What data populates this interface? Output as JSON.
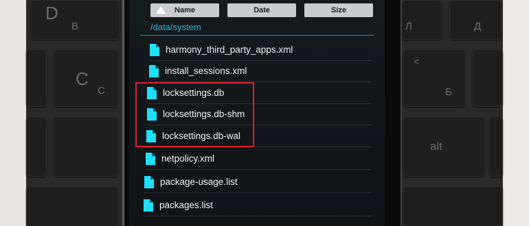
{
  "header": {
    "sort_name": "Name",
    "sort_date": "Date",
    "sort_size": "Size"
  },
  "path": "/data/system",
  "files": [
    "harmony_third_party_apps.xml",
    "install_sessions.xml",
    "locksettings.db",
    "locksettings.db-shm",
    "locksettings.db-wal",
    "netpolicy.xml",
    "package-usage.list",
    "packages.list"
  ],
  "keys": {
    "d": "D",
    "v": "В",
    "c": "C",
    "s": "С",
    "l": "Л",
    "d_cyr": "Д",
    "lt": "<",
    "b": "Б",
    "alt": "alt"
  },
  "colors": {
    "accent": "#2ebbd8",
    "file_icon": "#1ee0ff",
    "highlight": "#e0202a"
  }
}
